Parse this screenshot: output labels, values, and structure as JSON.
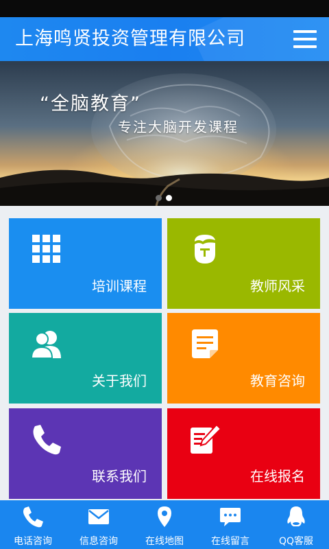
{
  "header": {
    "title": "上海鸣贤投资管理有限公司"
  },
  "banner": {
    "headline": "“全脑教育”",
    "subline": "专注大脑开发课程",
    "slide_count": 2,
    "active_slide": 2
  },
  "tiles": [
    {
      "label": "培训课程",
      "icon": "grid-icon",
      "color": "#1a8ef0"
    },
    {
      "label": "教师风采",
      "icon": "teacher-face-icon",
      "color": "#9ab800"
    },
    {
      "label": "关于我们",
      "icon": "people-icon",
      "color": "#13aaa0"
    },
    {
      "label": "教育咨询",
      "icon": "document-icon",
      "color": "#ff8a00"
    },
    {
      "label": "联系我们",
      "icon": "phone-icon",
      "color": "#5c35b4"
    },
    {
      "label": "在线报名",
      "icon": "edit-form-icon",
      "color": "#e90012"
    }
  ],
  "bottom_nav": [
    {
      "label": "电话咨询",
      "icon": "phone-icon"
    },
    {
      "label": "信息咨询",
      "icon": "envelope-icon"
    },
    {
      "label": "在线地图",
      "icon": "map-pin-icon"
    },
    {
      "label": "在线留言",
      "icon": "chat-bubble-icon"
    },
    {
      "label": "QQ客服",
      "icon": "qq-penguin-icon"
    }
  ]
}
